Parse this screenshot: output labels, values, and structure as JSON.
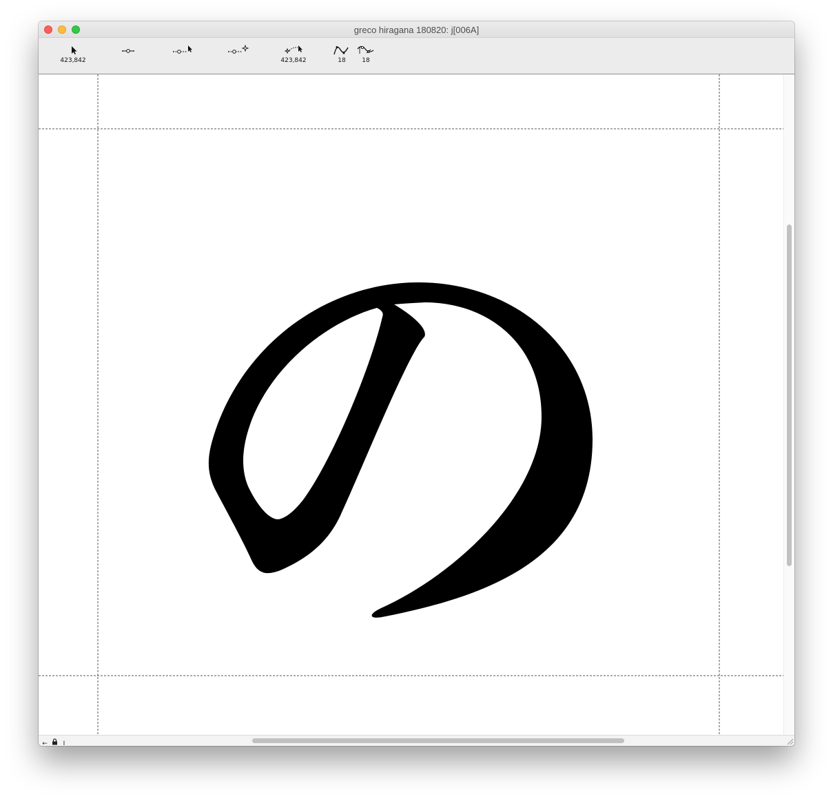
{
  "window": {
    "title": "greco hiragana 180820: j[006A]"
  },
  "toolbar": {
    "tools": [
      {
        "name": "pointer-tool",
        "icon": "pointer-arrow-icon",
        "label": "423,842"
      },
      {
        "name": "point-tool",
        "icon": "curve-point-icon",
        "label": ""
      },
      {
        "name": "add-point-tool",
        "icon": "point-with-pointer-icon",
        "label": ""
      },
      {
        "name": "tangent-point-tool",
        "icon": "point-with-star-icon",
        "label": ""
      },
      {
        "name": "ruler-tool",
        "icon": "measure-pointer-icon",
        "label": "423,842"
      },
      {
        "name": "curve-tool",
        "icon": "spline-curve-icon",
        "label": "18"
      },
      {
        "name": "spiro-tool",
        "icon": "spiro-curve-icon",
        "label": "18"
      }
    ]
  },
  "statusbar": {
    "icons": [
      "left-arrow-icon",
      "lock-icon",
      "text-cursor-icon"
    ]
  },
  "colors": {
    "glyph": "#000000",
    "guide": "#555555",
    "toolbar": "#ececec"
  }
}
